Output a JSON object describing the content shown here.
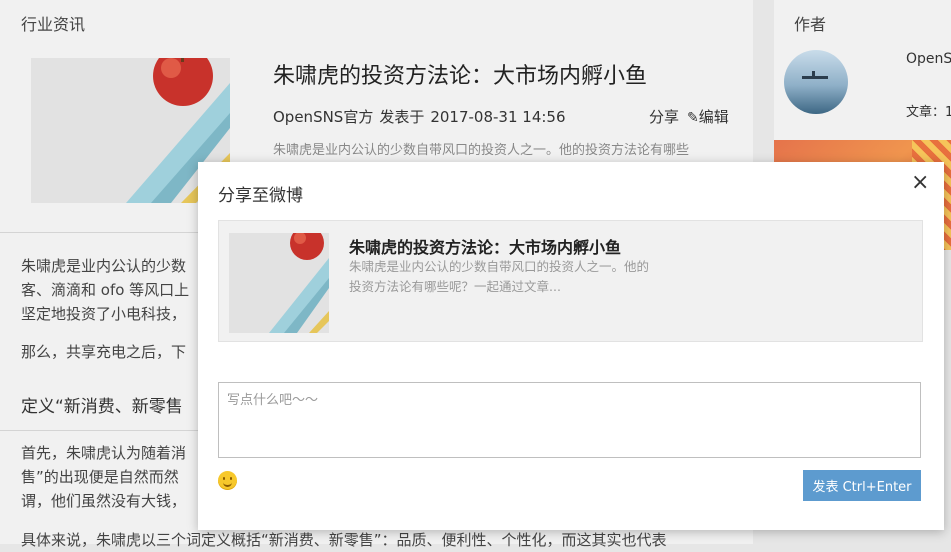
{
  "page": {
    "section_heading": "行业资讯",
    "article": {
      "title": "朱啸虎的投资方法论：大市场内孵小鱼",
      "author": "OpenSNS官方",
      "posted_label": "发表于",
      "date": "2017-08-31 14:56",
      "share_label": "分享",
      "edit_label": "编辑",
      "summary": "朱啸虎是业内公认的少数自带风口的投资人之一。他的投资方法论有哪些"
    },
    "body_lines": [
      "朱啸虎是业内公认的少数",
      "客、滴滴和 ofo 等风口上",
      "坚定地投资了小电科技，"
    ],
    "body_para2": "那么，共享充电之后，下",
    "subheading": "定义“新消费、新零售",
    "body_lines2": [
      "首先，朱啸虎认为随着消",
      "售”的出现便是自然而然",
      "谓，他们虽然没有大钱，"
    ],
    "body_last": "具体来说，朱啸虎以三个词定义概括“新消费、新零售”：品质、便利性、个性化，而这其实也代表"
  },
  "sidebar": {
    "author_heading": "作者",
    "author_name": "OpenSNS",
    "article_count_label": "文章：1"
  },
  "modal": {
    "title": "分享至微博",
    "close_glyph": "×",
    "card": {
      "title": "朱啸虎的投资方法论：大市场内孵小鱼",
      "description": "朱啸虎是业内公认的少数自带风口的投资人之一。他的投资方法论有哪些呢？一起通过文章..."
    },
    "comment_placeholder": "写点什么吧～～",
    "publish_label": "发表 Ctrl+Enter",
    "emoji_icon": "smiley-face-icon"
  },
  "colors": {
    "publish_button": "#5d9bcf",
    "emoji": "#f7c82b",
    "banner": "#e5734b"
  }
}
